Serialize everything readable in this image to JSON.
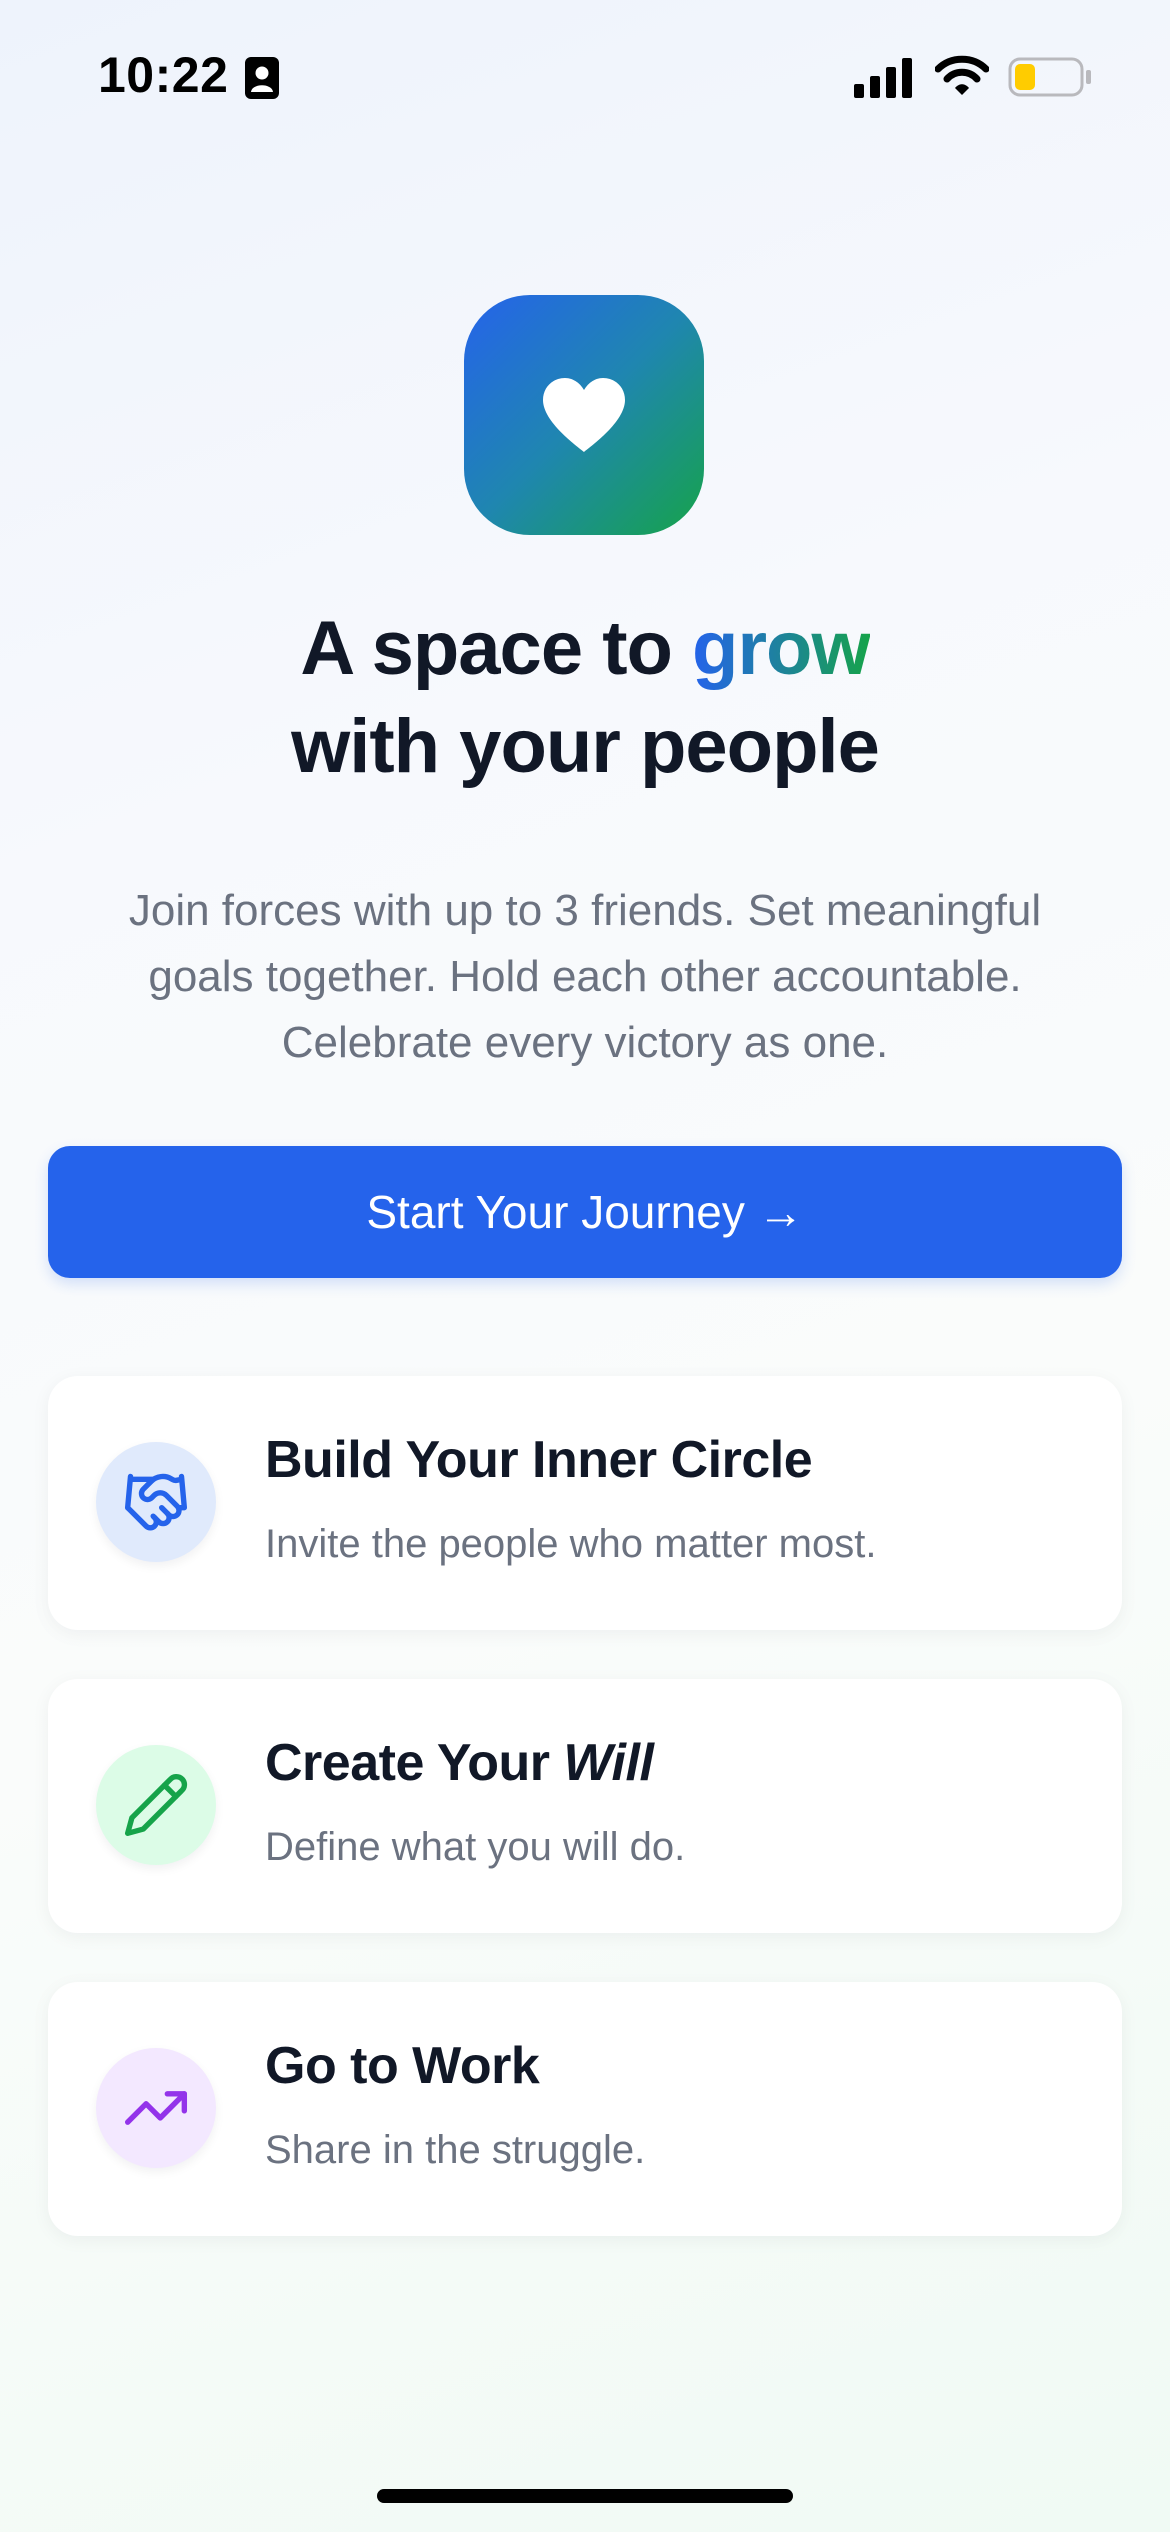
{
  "status_bar": {
    "time": "10:22"
  },
  "hero": {
    "headline_part1": "A space to ",
    "headline_highlight": "grow",
    "headline_line2": "with your people",
    "description": "Join forces with up to 3 friends. Set meaningful goals together. Hold each other accountable. Celebrate every victory as one."
  },
  "cta": {
    "label": "Start Your Journey →"
  },
  "features": [
    {
      "title": "Build Your Inner Circle",
      "subtitle": "Invite the people who matter most.",
      "icon": "handshake-icon",
      "icon_bg": "#e0eafc",
      "icon_color": "#2563eb"
    },
    {
      "title_prefix": "Create Your ",
      "title_em": "Will",
      "subtitle": "Define what you will do.",
      "icon": "pencil-icon",
      "icon_bg": "#dcfce7",
      "icon_color": "#16a34a"
    },
    {
      "title": "Go to Work",
      "subtitle": "Share in the struggle.",
      "icon": "trending-up-icon",
      "icon_bg": "#f3e8ff",
      "icon_color": "#9333ea"
    }
  ],
  "colors": {
    "primary": "#2563eb",
    "accent_green": "#16a34a",
    "text_dark": "#111827",
    "text_muted": "#6b7280"
  }
}
